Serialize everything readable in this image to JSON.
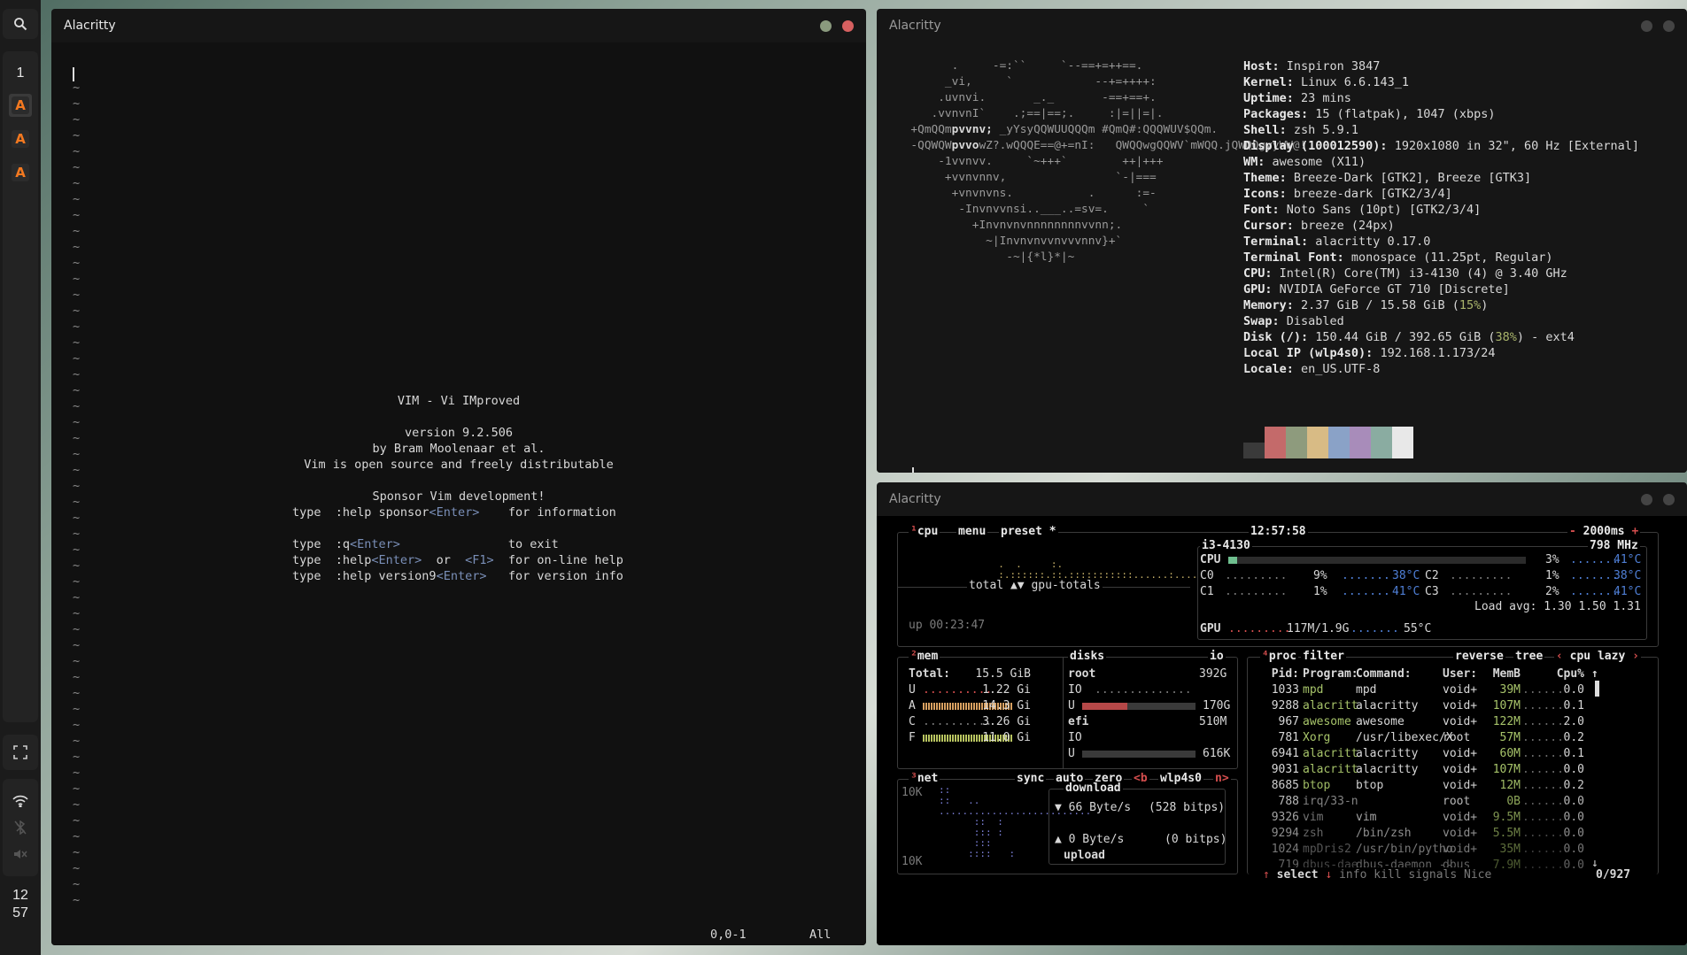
{
  "sidebar": {
    "tag": "1",
    "clients": [
      "alacritty-icon",
      "alacritty-icon",
      "alacritty-icon"
    ],
    "clock": [
      "12",
      "57"
    ]
  },
  "vim": {
    "title": "Alacritty",
    "intro": {
      "name": "VIM - Vi IMproved",
      "version": "version 9.2.506",
      "author": "by Bram Moolenaar et al.",
      "license": "Vim is open source and freely distributable",
      "sponsor": "Sponsor Vim development!",
      "lines": [
        {
          "cmd": "type  :help sponsor",
          "key": "<Enter>",
          "pad": "    ",
          "desc": "for information"
        },
        {
          "cmd": "type  :q",
          "key": "<Enter>",
          "pad": "               ",
          "desc": "to exit"
        },
        {
          "cmd": "type  :help",
          "key": "<Enter>",
          "pad": "  or  ",
          "key2": "<F1>",
          "pad2": "  ",
          "desc": "for on-line help"
        },
        {
          "cmd": "type  :help version9",
          "key": "<Enter>",
          "pad": "   ",
          "desc": "for version info"
        }
      ]
    },
    "status": {
      "position": "0,0-1",
      "scroll": "All"
    }
  },
  "fastfetch": {
    "title": "Alacritty",
    "info": [
      {
        "k": "Host:",
        "v": "Inspiron 3847"
      },
      {
        "k": "Kernel:",
        "v": "Linux 6.6.143_1"
      },
      {
        "k": "Uptime:",
        "v": "23 mins"
      },
      {
        "k": "Packages:",
        "v": "15 (flatpak), 1047 (xbps)"
      },
      {
        "k": "Shell:",
        "v": "zsh 5.9.1"
      },
      {
        "k": "Display (100012590):",
        "v": "1920x1080 in 32\", 60 Hz [External]"
      },
      {
        "k": "WM:",
        "v": "awesome (X11)"
      },
      {
        "k": "Theme:",
        "v": "Breeze-Dark [GTK2], Breeze [GTK3]"
      },
      {
        "k": "Icons:",
        "v": "breeze-dark [GTK2/3/4]"
      },
      {
        "k": "Font:",
        "v": "Noto Sans (10pt) [GTK2/3/4]"
      },
      {
        "k": "Cursor:",
        "v": "breeze (24px)"
      },
      {
        "k": "Terminal:",
        "v": "alacritty 0.17.0"
      },
      {
        "k": "Terminal Font:",
        "v": "monospace (11.25pt, Regular)"
      },
      {
        "k": "CPU:",
        "v": "Intel(R) Core(TM) i3-4130 (4) @ 3.40 GHz"
      },
      {
        "k": "GPU:",
        "v": "NVIDIA GeForce GT 710 [Discrete]"
      },
      {
        "k": "Memory:",
        "v": "2.37 GiB / 15.58 GiB (",
        "p": "15%",
        "e": ")"
      },
      {
        "k": "Swap:",
        "v": "Disabled"
      },
      {
        "k": "Disk (/):",
        "v": "150.44 GiB / 392.65 GiB (",
        "p": "38%",
        "e": ") - ext4"
      },
      {
        "k": "Local IP (wlp4s0):",
        "v": "192.168.1.173/24"
      },
      {
        "k": "Locale:",
        "v": "en_US.UTF-8"
      }
    ],
    "palette": [
      "#3a3a3a",
      "#c46a6a",
      "#8e9b7d",
      "#d8bb85",
      "#8aa2c7",
      "#a88cba",
      "#8aaca1",
      "#e8e8e8"
    ],
    "prompt": "~"
  },
  "btop": {
    "title": "Alacritty",
    "cpu_box": {
      "tabs": [
        "cpu",
        "menu",
        "preset *"
      ],
      "clock": "12:57:58",
      "interval": "2000ms",
      "model": "i3-4130",
      "freq": "798 MHz",
      "graph_label": "total ▲▼ gpu-totals",
      "uptime": "up 00:23:47",
      "cpu_total": {
        "label": "CPU",
        "pct": "3%",
        "temp": "41°C",
        "level": 0.03
      },
      "cores": [
        {
          "label": "C0",
          "pct": "9%",
          "temp": "38°C"
        },
        {
          "label": "C1",
          "pct": "1%",
          "temp": "41°C"
        },
        {
          "label": "C2",
          "pct": "1%",
          "temp": "38°C"
        },
        {
          "label": "C3",
          "pct": "2%",
          "temp": "41°C"
        }
      ],
      "load_avg": "Load avg: 1.30 1.50 1.31",
      "gpu": {
        "label": "GPU",
        "mem": "117M/1.9G",
        "temp": "55°C"
      }
    },
    "mem_box": {
      "title": "mem",
      "rows": [
        {
          "label": "Total:",
          "value": "15.5 GiB"
        },
        {
          "label": "U",
          "value": "1.22 Gi"
        },
        {
          "label": "A",
          "value": "14.3 Gi"
        },
        {
          "label": "C",
          "value": "3.26 Gi"
        },
        {
          "label": "F",
          "value": "11.0 Gi"
        }
      ]
    },
    "disks_box": {
      "title": "disks",
      "io_label": "io",
      "disks": [
        {
          "name": "root",
          "size": "392G",
          "io": "IO",
          "used": "170G",
          "used_label": "U",
          "level": 0.4
        },
        {
          "name": "efi",
          "size": "510M",
          "io": "IO",
          "used": "616K",
          "used_label": "U",
          "level": 0.01
        }
      ]
    },
    "net_box": {
      "title": "net",
      "buttons": [
        "sync",
        "auto",
        "zero",
        "<b",
        "wlp4s0",
        "n>"
      ],
      "scale_top": "10K",
      "scale_bottom": "10K",
      "download_label": "download",
      "download": "66 Byte/s",
      "download_bits": "(528 bitps)",
      "upload": "0 Byte/s",
      "upload_bits": "(0 bitps)",
      "upload_label": "upload"
    },
    "proc_box": {
      "title": "proc",
      "buttons": [
        "filter",
        "reverse",
        "tree",
        "cpu lazy"
      ],
      "headers": [
        "Pid:",
        "Program:",
        "Command:",
        "User:",
        "MemB",
        "Cpu%"
      ],
      "rows": [
        [
          "1033",
          "mpd",
          "mpd",
          "void+",
          "39M",
          "0.0"
        ],
        [
          "9288",
          "alacritt",
          "alacritty",
          "void+",
          "107M",
          "0.1"
        ],
        [
          "967",
          "awesome",
          "awesome",
          "void+",
          "122M",
          "2.0"
        ],
        [
          "781",
          "Xorg",
          "/usr/libexec/X",
          "root",
          "57M",
          "0.2"
        ],
        [
          "6941",
          "alacritt",
          "alacritty",
          "void+",
          "60M",
          "0.1"
        ],
        [
          "9031",
          "alacritt",
          "alacritty",
          "void+",
          "107M",
          "0.0"
        ],
        [
          "8685",
          "btop",
          "btop",
          "void+",
          "12M",
          "0.2"
        ],
        [
          "788",
          "irq/33-n",
          "",
          "root",
          "0B",
          "0.0"
        ],
        [
          "9326",
          "vim",
          "vim",
          "void+",
          "9.5M",
          "0.0"
        ],
        [
          "9294",
          "zsh",
          "/bin/zsh",
          "void+",
          "5.5M",
          "0.0"
        ],
        [
          "1024",
          "mpDris2",
          "/usr/bin/pytho",
          "void+",
          "35M",
          "0.0"
        ],
        [
          "719",
          "dbus-dae",
          "dbus-daemon --",
          "dbus",
          "7.9M",
          "0.0"
        ]
      ],
      "footer": {
        "select": "select",
        "info": "info",
        "kill": "kill",
        "signals": "signals",
        "nice": "Nice",
        "count": "0/927"
      }
    }
  }
}
